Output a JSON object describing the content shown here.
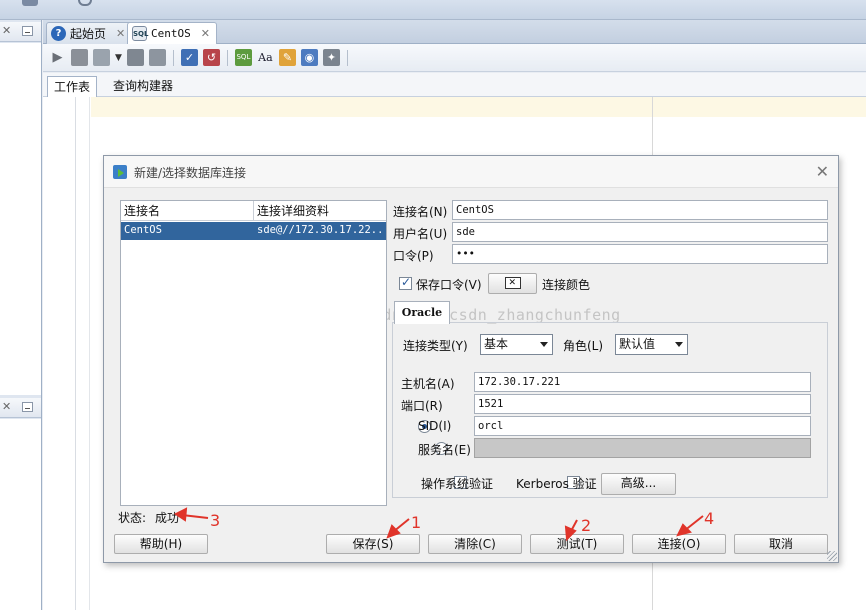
{
  "ide": {
    "tabs": [
      {
        "label": "起始页"
      },
      {
        "label": "CentOS"
      }
    ],
    "subtabs": [
      {
        "label": "工作表"
      },
      {
        "label": "查询构建器"
      }
    ]
  },
  "dialog": {
    "title": "新建/选择数据库连接",
    "list": {
      "headers": [
        "连接名",
        "连接详细资料"
      ],
      "rows": [
        {
          "name": "CentOS",
          "detail": "sde@//172.30.17.22..."
        }
      ]
    },
    "form": {
      "conn_name_label": "连接名(N)",
      "conn_name_value": "CentOS",
      "username_label": "用户名(U)",
      "username_value": "sde",
      "password_label": "口令(P)",
      "password_value": "•••",
      "save_password_label": "保存口令(V)",
      "conn_color_label": "连接颜色",
      "oracle_tab": "Oracle",
      "conn_type_label": "连接类型(Y)",
      "conn_type_value": "基本",
      "role_label": "角色(L)",
      "role_value": "默认值",
      "host_label": "主机名(A)",
      "host_value": "172.30.17.221",
      "port_label": "端口(R)",
      "port_value": "1521",
      "sid_label": "SID(I)",
      "sid_value": "orcl",
      "service_label": "服务名(E)",
      "os_auth_label": "操作系统验证",
      "kerberos_label": "Kerberos 验证",
      "advanced_button": "高级..."
    },
    "status": {
      "label": "状态:",
      "value": "成功"
    },
    "buttons": {
      "help": "帮助(H)",
      "save": "保存(S)",
      "clear": "清除(C)",
      "test": "测试(T)",
      "connect": "连接(O)",
      "cancel": "取消"
    },
    "watermark": "http://blog.csdn.net/csdn_zhangchunfeng"
  },
  "annotations": {
    "n1": "1",
    "n2": "2",
    "n3": "3",
    "n4": "4",
    "color": "#e0342a"
  },
  "icons": [
    "close-icon",
    "minimize-icon",
    "help-tab-icon",
    "sql-tab-icon",
    "run-icon",
    "stop-icon",
    "dialog-icon",
    "connection-color-icon",
    "dropdown-arrow-icon"
  ]
}
